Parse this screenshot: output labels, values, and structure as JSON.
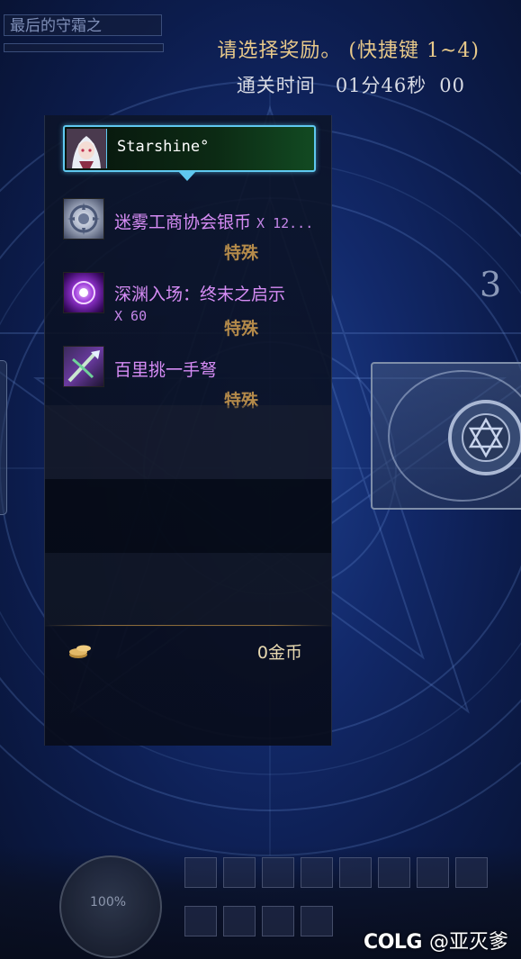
{
  "hud_top": {
    "dungeon_name": "最后的守霜之",
    "prompt": "请选择奖励。 (快捷键 1~4)",
    "clear_time_label": "通关时间",
    "clear_time_value": "01分46秒",
    "clear_time_ms": "00"
  },
  "player": {
    "name": "Starshine°"
  },
  "rewards": [
    {
      "name": "迷雾工商协会银币",
      "qty": "X 12...",
      "rarity": "特殊",
      "icon": "silver-coin-icon"
    },
    {
      "name": "深渊入场：终末之启示",
      "qty": "X 60",
      "rarity": "特殊",
      "icon": "abyss-orb-icon"
    },
    {
      "name": "百里挑一手弩",
      "qty": "",
      "rarity": "特殊",
      "icon": "crossbow-icon"
    }
  ],
  "gold": {
    "value": "0金币",
    "icon": "gold-coins-icon"
  },
  "card": {
    "number": "3",
    "icon": "star-gear-icon"
  },
  "bottom_hud": {
    "hp_percent": "100%"
  },
  "watermark": {
    "brand": "COLG",
    "handle": "@亚灭爹"
  },
  "colors": {
    "prompt": "#e8c98a",
    "item_name": "#d68cf5",
    "rarity": "#b48a4a",
    "player_frame": "#5fc8f0"
  }
}
